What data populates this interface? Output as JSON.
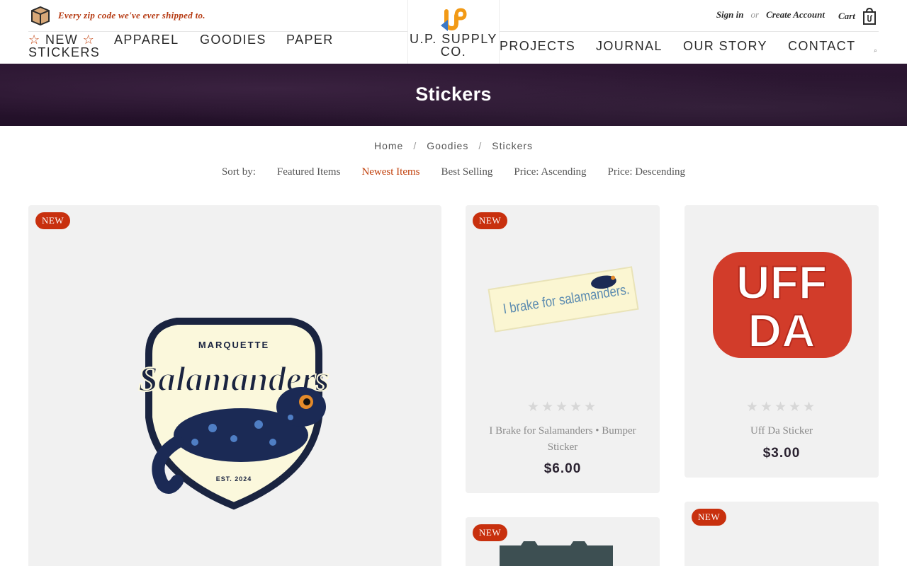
{
  "header": {
    "promo_text": "Every zip code we've ever shipped to.",
    "logo_text": "U.P. SUPPLY CO.",
    "nav": {
      "new_stickers": "NEW",
      "new_stickers_line2": "STICKERS",
      "star_glyph": "☆",
      "apparel": "APPAREL",
      "goodies": "GOODIES",
      "paper": "PAPER",
      "projects": "PROJECTS",
      "journal": "JOURNAL",
      "our_story": "OUR STORY",
      "contact": "CONTACT"
    },
    "account": {
      "sign_in": "Sign in",
      "or": "or",
      "create_account": "Create Account"
    },
    "cart_label": "Cart"
  },
  "banner": {
    "title": "Stickers"
  },
  "breadcrumb": [
    "Home",
    "Goodies",
    "Stickers"
  ],
  "sort": {
    "label": "Sort by:",
    "options": [
      "Featured Items",
      "Newest Items",
      "Best Selling",
      "Price: Ascending",
      "Price: Descending"
    ],
    "active": "Newest Items"
  },
  "products": [
    {
      "badge": "NEW",
      "image_text": {
        "top": "MARQUETTE",
        "main": "Salamanders",
        "est": "EST. 2024"
      }
    },
    {
      "badge": "NEW",
      "image_text": "I brake for salamanders.",
      "name": "I Brake for Salamanders • Bumper Sticker",
      "price": "$6.00",
      "rating": 0
    },
    {
      "badge": null,
      "image_text": "UFF DA",
      "name": "Uff Da Sticker",
      "price": "$3.00",
      "rating": 0
    },
    {
      "badge": "NEW"
    },
    {
      "badge": "NEW"
    }
  ],
  "colors": {
    "accent": "#c2410c",
    "badge": "#c8300e",
    "banner": "#2a1530",
    "card": "#f1f1f1"
  }
}
